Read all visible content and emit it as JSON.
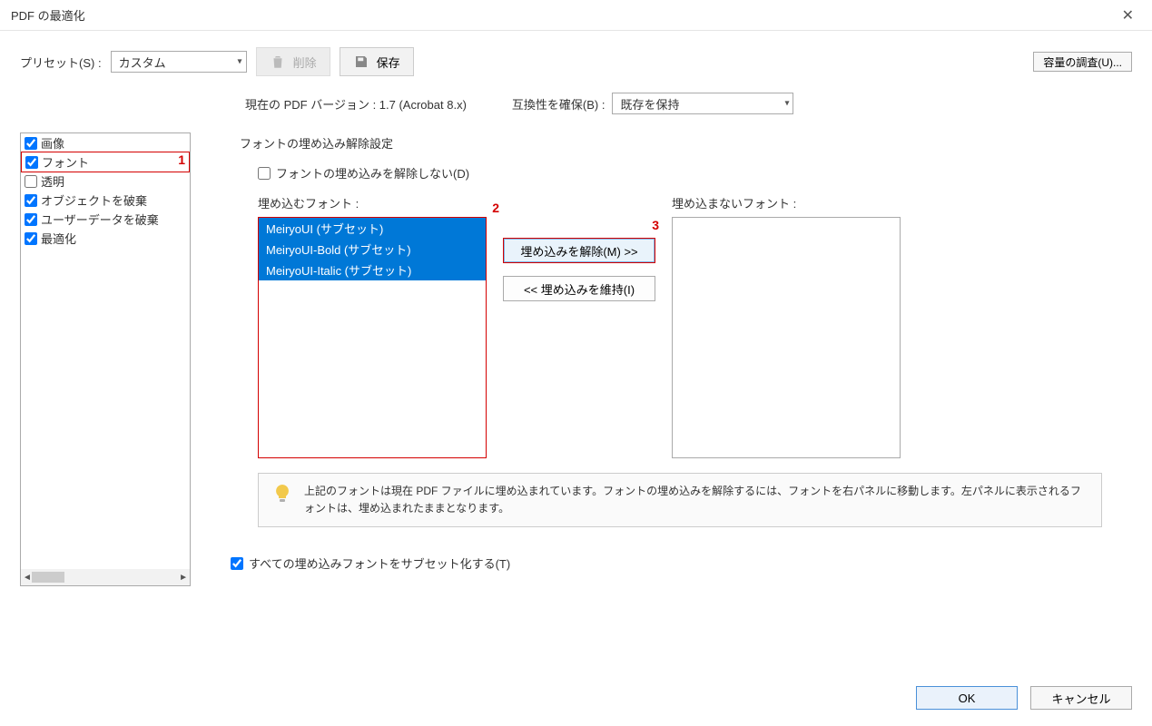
{
  "title": "PDF の最適化",
  "preset": {
    "label": "プリセット(S) :",
    "value": "カスタム"
  },
  "buttons": {
    "delete": "削除",
    "save": "保存",
    "audit": "容量の調査(U)...",
    "ok": "OK",
    "cancel": "キャンセル"
  },
  "version": {
    "text": "現在の PDF バージョン : 1.7 (Acrobat 8.x)"
  },
  "compat": {
    "label": "互換性を確保(B) :",
    "value": "既存を保持"
  },
  "categories": {
    "items": [
      {
        "label": "画像",
        "checked": true
      },
      {
        "label": "フォント",
        "checked": true
      },
      {
        "label": "透明",
        "checked": false
      },
      {
        "label": "オブジェクトを破棄",
        "checked": true
      },
      {
        "label": "ユーザーデータを破棄",
        "checked": true
      },
      {
        "label": "最適化",
        "checked": true
      }
    ]
  },
  "fonts": {
    "section_title": "フォントの埋め込み解除設定",
    "do_not_unembed": "フォントの埋め込みを解除しない(D)",
    "embed_label": "埋め込むフォント :",
    "unembed_label": "埋め込まないフォント :",
    "embed_list": [
      "MeiryoUI (サブセット)",
      "MeiryoUI-Bold (サブセット)",
      "MeiryoUI-Italic (サブセット)"
    ],
    "btn_unembed": "埋め込みを解除(M) >>",
    "btn_keep": "<< 埋め込みを維持(I)",
    "info": "上記のフォントは現在 PDF ファイルに埋め込まれています。フォントの埋め込みを解除するには、フォントを右パネルに移動します。左パネルに表示されるフォントは、埋め込まれたままとなります。",
    "subset_all": "すべての埋め込みフォントをサブセット化する(T)"
  },
  "annotations": {
    "one": "1",
    "two": "2",
    "three": "3"
  }
}
